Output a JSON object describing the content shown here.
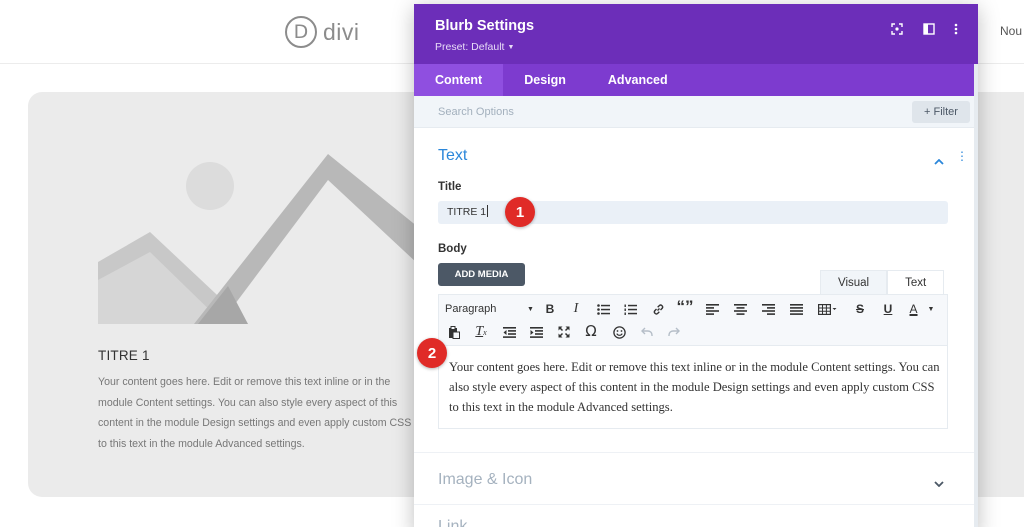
{
  "background": {
    "logo_letter": "D",
    "logo_text": "divi",
    "nav_partial": "Nou",
    "blurb_title": "TITRE 1",
    "blurb_body": "Your content goes here. Edit or remove this text inline or in the module Content settings. You can also style every aspect of this content in the module Design settings and even apply custom CSS to this text in the module Advanced settings."
  },
  "modal": {
    "title": "Blurb Settings",
    "preset": "Preset: Default",
    "header_icons": [
      "focus-icon",
      "split-view-icon",
      "more-vertical-icon"
    ],
    "tabs": [
      {
        "label": "Content",
        "active": true
      },
      {
        "label": "Design",
        "active": false
      },
      {
        "label": "Advanced",
        "active": false
      }
    ],
    "search_placeholder": "Search Options",
    "filter_label": "+ Filter",
    "text_section": {
      "title": "Text",
      "title_label": "Title",
      "title_value": "TITRE 1",
      "body_label": "Body",
      "add_media": "ADD MEDIA",
      "editor_tabs": [
        "Visual",
        "Text"
      ],
      "toolbar": {
        "paragraph_select": "Paragraph",
        "tools": [
          "bold",
          "italic",
          "bullet-list",
          "numbered-list",
          "link",
          "blockquote",
          "align-left",
          "align-center",
          "align-right",
          "justify",
          "table",
          "strikethrough",
          "underline",
          "text-color",
          "paste-text",
          "clear-formatting",
          "outdent",
          "indent",
          "fullscreen",
          "special-character",
          "emoji",
          "undo",
          "redo"
        ],
        "bold": "B",
        "italic": "I",
        "quote": "“”",
        "strike": "S",
        "underline": "U",
        "color": "A",
        "clear": "T",
        "omega": "Ω"
      },
      "body_value": "Your content goes here. Edit or remove this text inline or in the module Content settings. You can also style every aspect of this content in the module Design settings and even apply custom CSS to this text in the module Advanced settings."
    },
    "other_sections": [
      "Image & Icon",
      "Link"
    ]
  },
  "badges": [
    "1",
    "2"
  ],
  "colors": {
    "header_purple": "#6c2eb9",
    "tab_purple": "#7d3bcf",
    "accent_blue": "#2b87da",
    "badge_red": "#e02b27"
  }
}
